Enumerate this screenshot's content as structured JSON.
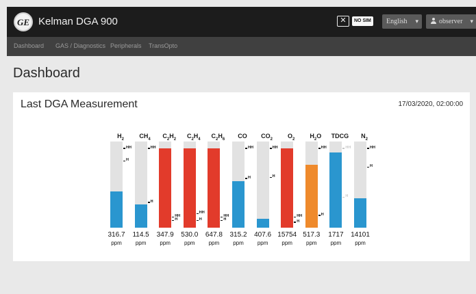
{
  "header": {
    "logo_text": "GE",
    "app_title": "Kelman DGA 900",
    "sim_status": "NO SIM",
    "language": "English",
    "user": "observer"
  },
  "nav": {
    "items": [
      "Dashboard",
      "GAS / Diagnostics",
      "Peripherals",
      "TransOpto"
    ]
  },
  "page": {
    "title": "Dashboard"
  },
  "measurement": {
    "title": "Last DGA Measurement",
    "timestamp": "17/03/2020, 02:00:00",
    "colors": {
      "normal": "#2a96cf",
      "caution": "#ef8a2c",
      "alarm": "#e23b2b",
      "track": "#e2e2e2"
    },
    "gases": [
      {
        "label": "H",
        "sub": "2",
        "value": "316.7",
        "unit": "ppm",
        "status": "normal",
        "fill": 0.42,
        "marks": [
          {
            "text": "HH",
            "level": 0.92,
            "faded": false
          },
          {
            "text": "H",
            "level": 0.77,
            "faded": false
          }
        ]
      },
      {
        "label": "CH",
        "sub": "4",
        "value": "114.5",
        "unit": "ppm",
        "status": "normal",
        "fill": 0.27,
        "marks": [
          {
            "text": "HH",
            "level": 0.92,
            "faded": false
          },
          {
            "text": "H",
            "level": 0.29,
            "faded": false
          }
        ]
      },
      {
        "label": "C",
        "sub": "2",
        "label2": "H",
        "sub2": "2",
        "value": "347.9",
        "unit": "ppm",
        "status": "alarm",
        "fill": 0.92,
        "marks": [
          {
            "text": "HH",
            "level": 0.12,
            "faded": false
          },
          {
            "text": "H",
            "level": 0.08,
            "faded": false
          }
        ]
      },
      {
        "label": "C",
        "sub": "2",
        "label2": "H",
        "sub2": "4",
        "value": "530.0",
        "unit": "ppm",
        "status": "alarm",
        "fill": 0.92,
        "marks": [
          {
            "text": "HH",
            "level": 0.16,
            "faded": false
          },
          {
            "text": "H",
            "level": 0.08,
            "faded": false
          }
        ]
      },
      {
        "label": "C",
        "sub": "2",
        "label2": "H",
        "sub2": "6",
        "value": "647.8",
        "unit": "ppm",
        "status": "alarm",
        "fill": 0.92,
        "marks": [
          {
            "text": "HH",
            "level": 0.12,
            "faded": false
          },
          {
            "text": "H",
            "level": 0.08,
            "faded": false
          }
        ]
      },
      {
        "label": "CO",
        "value": "315.2",
        "unit": "ppm",
        "status": "normal",
        "fill": 0.54,
        "marks": [
          {
            "text": "HH",
            "level": 0.92,
            "faded": false
          },
          {
            "text": "H",
            "level": 0.57,
            "faded": false
          }
        ]
      },
      {
        "label": "CO",
        "sub": "2",
        "value": "407.6",
        "unit": "ppm",
        "status": "normal",
        "fill": 0.1,
        "marks": [
          {
            "text": "HH",
            "level": 0.92,
            "faded": false
          },
          {
            "text": "H",
            "level": 0.58,
            "faded": false
          }
        ]
      },
      {
        "label": "O",
        "sub": "2",
        "value": "15754",
        "unit": "ppm",
        "status": "alarm",
        "fill": 0.92,
        "marks": [
          {
            "text": "HH",
            "level": 0.12,
            "faded": false
          },
          {
            "text": "H",
            "level": 0.06,
            "faded": false
          }
        ]
      },
      {
        "label": "H",
        "sub": "2",
        "label2": "O",
        "value": "517.3",
        "unit": "ppm",
        "status": "caution",
        "fill": 0.73,
        "marks": [
          {
            "text": "HH",
            "level": 0.92,
            "faded": false
          },
          {
            "text": "H",
            "level": 0.14,
            "faded": false
          }
        ]
      },
      {
        "label": "TDCG",
        "value": "1717",
        "unit": "ppm",
        "status": "normal",
        "fill": 0.87,
        "marks": [
          {
            "text": "HH",
            "level": 0.92,
            "faded": true
          },
          {
            "text": "H",
            "level": 0.35,
            "faded": true
          }
        ]
      },
      {
        "label": "N",
        "sub": "2",
        "value": "14101",
        "unit": "ppm",
        "status": "normal",
        "fill": 0.34,
        "marks": [
          {
            "text": "HH",
            "level": 0.92,
            "faded": false
          },
          {
            "text": "H",
            "level": 0.7,
            "faded": false
          }
        ]
      }
    ]
  }
}
